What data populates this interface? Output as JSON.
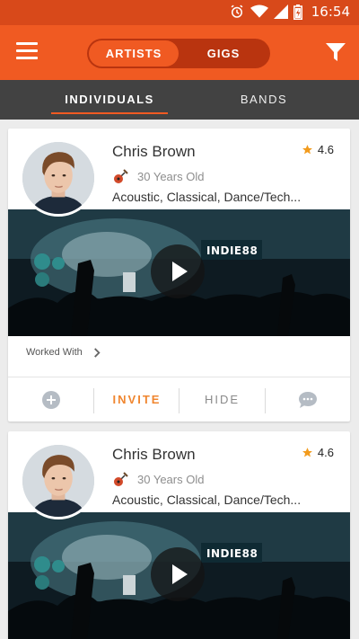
{
  "status": {
    "time": "16:54"
  },
  "header": {
    "segments": [
      {
        "label": "ARTISTS"
      },
      {
        "label": "GIGS"
      }
    ],
    "icons": {
      "menu": "hamburger-icon",
      "filter": "funnel-icon"
    }
  },
  "tabs": [
    {
      "label": "INDIVIDUALS"
    },
    {
      "label": "BANDS"
    }
  ],
  "colors": {
    "brand": "#f05a22",
    "status_bar": "#d8491a",
    "tab_bar": "#424242",
    "star": "#f29b1d",
    "invite": "#f0862f"
  },
  "cards": [
    {
      "name": "Chris Brown",
      "rating": "4.6",
      "age": "30 Years Old",
      "genres": "Acoustic, Classical, Dance/Tech...",
      "video_sign": "INDIE88",
      "worked_with": "Worked With",
      "actions": {
        "invite": "INVITE",
        "hide": "HIDE"
      }
    },
    {
      "name": "Chris Brown",
      "rating": "4.6",
      "age": "30 Years Old",
      "genres": "Acoustic, Classical, Dance/Tech...",
      "video_sign": "INDIE88"
    }
  ]
}
